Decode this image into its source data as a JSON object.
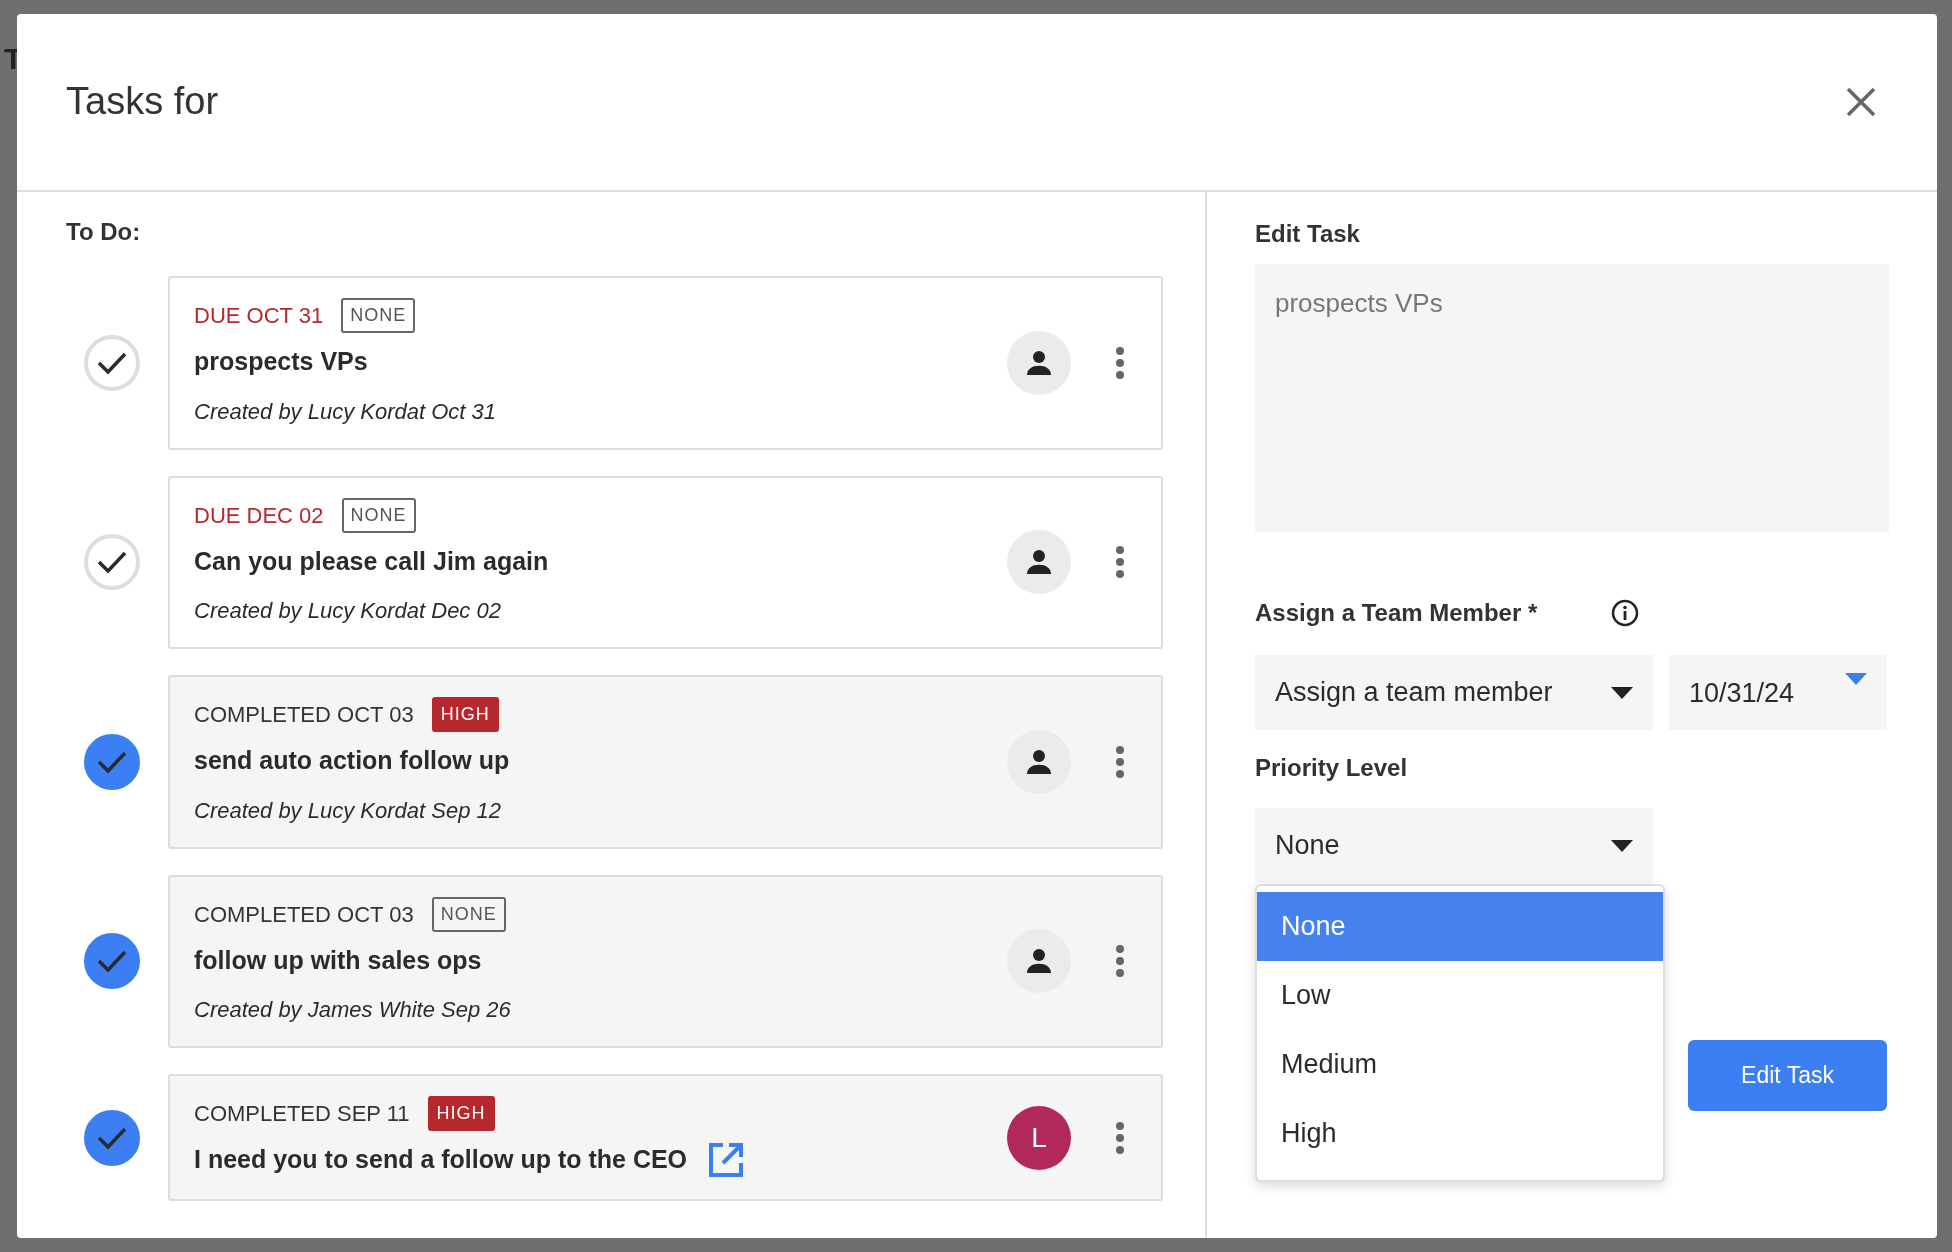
{
  "background": {
    "texts": [
      "T"
    ]
  },
  "modal": {
    "title": "Tasks for",
    "todo_label": "To Do:",
    "tasks": [
      {
        "completed": false,
        "status": "DUE OCT 31",
        "priority": {
          "label": "NONE"
        },
        "title": "prospects VPs",
        "created": "Created by Lucy Kordat Oct 31",
        "avatar": {
          "kind": "icon"
        },
        "link": false
      },
      {
        "completed": false,
        "status": "DUE DEC 02",
        "priority": {
          "label": "NONE"
        },
        "title": "Can you please call Jim again",
        "created": "Created by Lucy Kordat Dec 02",
        "avatar": {
          "kind": "icon"
        },
        "link": false
      },
      {
        "completed": true,
        "status": "COMPLETED OCT 03",
        "priority": {
          "label": "HIGH",
          "color": "#b7282e"
        },
        "title": "send auto action follow up",
        "created": "Created by Lucy Kordat Sep 12",
        "avatar": {
          "kind": "icon"
        },
        "link": false
      },
      {
        "completed": true,
        "status": "COMPLETED OCT 03",
        "priority": {
          "label": "NONE"
        },
        "title": "follow up with sales ops",
        "created": "Created by James White Sep 26",
        "avatar": {
          "kind": "icon"
        },
        "link": false
      },
      {
        "completed": true,
        "status": "COMPLETED SEP 11",
        "priority": {
          "label": "HIGH",
          "color": "#b7282e"
        },
        "title": "I need you to send a follow up to the CEO",
        "avatar": {
          "kind": "initial",
          "initial": "L",
          "color": "#b0295a"
        },
        "link": true
      }
    ],
    "edit": {
      "heading": "Edit Task",
      "description_placeholder": "prospects VPs",
      "assign_label": "Assign a Team Member *",
      "member_select": "Assign a team member",
      "date": "10/31/24",
      "priority_label": "Priority Level",
      "priority_select": "None",
      "priority_options": [
        {
          "label": "None",
          "selected": true
        },
        {
          "label": "Low",
          "selected": false
        },
        {
          "label": "Medium",
          "selected": false
        },
        {
          "label": "High",
          "selected": false
        }
      ],
      "submit": "Edit Task"
    }
  }
}
